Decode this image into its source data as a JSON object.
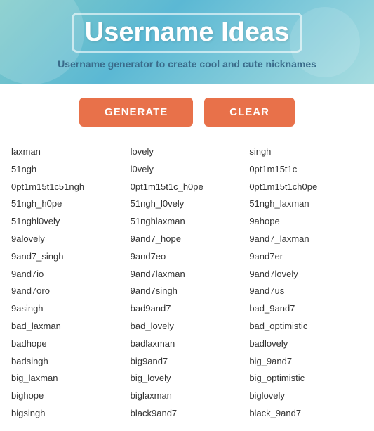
{
  "header": {
    "title": "Username Ideas",
    "subtitle": "Username generator to create cool and cute nicknames"
  },
  "buttons": {
    "generate": "GENERATE",
    "clear": "CLEAR"
  },
  "columns": [
    [
      "laxman",
      "51ngh",
      "0pt1m15t1c51ngh",
      "51ngh_h0pe",
      "51nghl0vely",
      "9alovely",
      "9and7_singh",
      "9and7io",
      "9and7oro",
      "9asingh",
      "bad_laxman",
      "badhope",
      "badsingh",
      "big_laxman",
      "bighope",
      "bigsingh"
    ],
    [
      "lovely",
      "l0vely",
      "0pt1m15t1c_h0pe",
      "51ngh_l0vely",
      "51nghlaxman",
      "9and7_hope",
      "9and7eo",
      "9and7laxman",
      "9and7singh",
      "bad9and7",
      "bad_lovely",
      "badlaxman",
      "big9and7",
      "big_lovely",
      "biglaxman",
      "black9and7"
    ],
    [
      "singh",
      "0pt1m15t1c",
      "0pt1m15t1ch0pe",
      "51ngh_laxman",
      "9ahope",
      "9and7_laxman",
      "9and7er",
      "9and7lovely",
      "9and7us",
      "bad_9and7",
      "bad_optimistic",
      "badlovely",
      "big_9and7",
      "big_optimistic",
      "biglovely",
      "black_9and7"
    ]
  ]
}
